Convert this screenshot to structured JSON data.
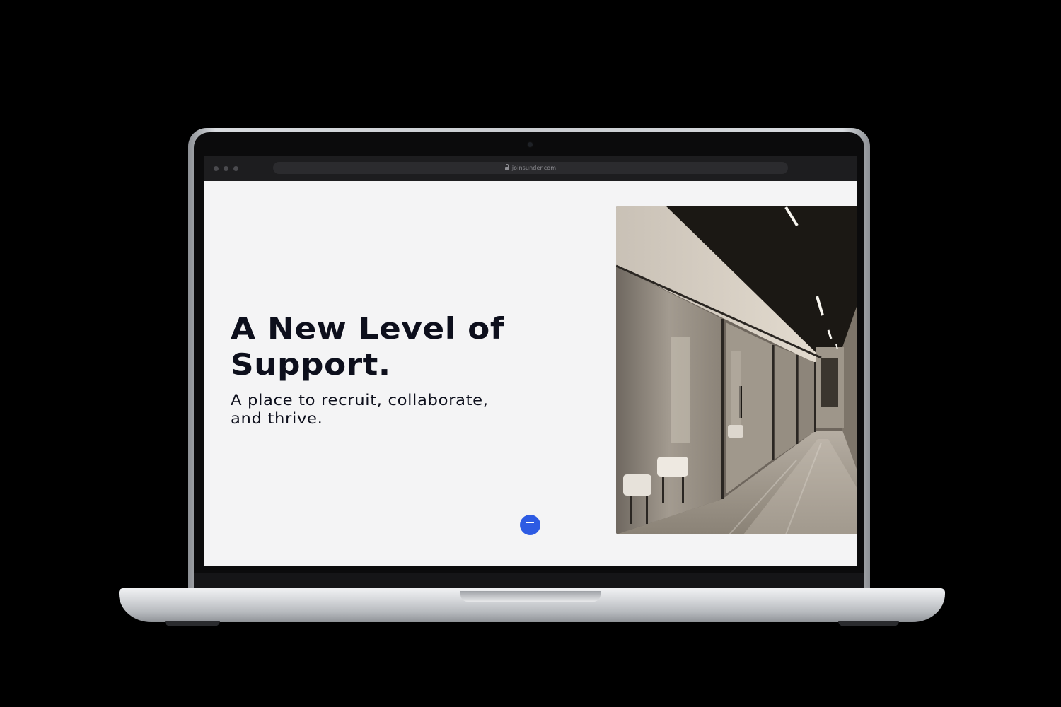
{
  "browser": {
    "url": "joinsunder.com"
  },
  "hero": {
    "title": "A New Level of Support.",
    "subtitle": "A place to recruit, collaborate, and thrive.",
    "image_description": "office corridor with glass-walled rooms"
  },
  "menu_button": {
    "icon": "hamburger-icon",
    "color": "#2d5be3"
  },
  "colors": {
    "page_background": "#f4f4f5",
    "heading": "#0d0f1c",
    "accent": "#2d5be3"
  }
}
